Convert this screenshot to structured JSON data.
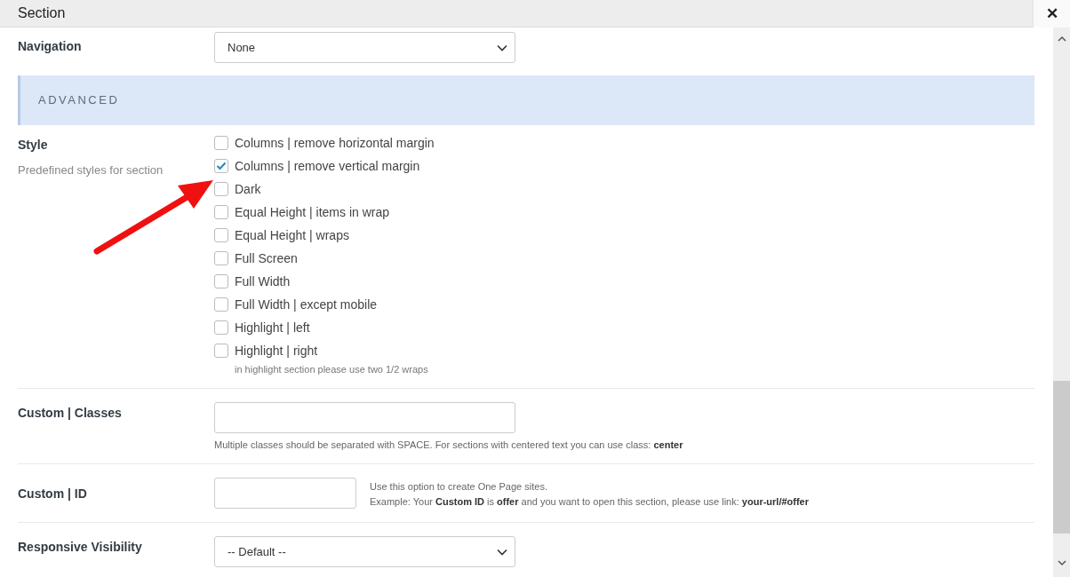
{
  "window": {
    "title": "Section",
    "close": "✕"
  },
  "navigation": {
    "label": "Navigation",
    "value": "None"
  },
  "advanced": {
    "heading": "ADVANCED"
  },
  "style": {
    "label": "Style",
    "description": "Predefined styles for section",
    "options": [
      {
        "label": "Columns | remove horizontal margin",
        "checked": false
      },
      {
        "label": "Columns | remove vertical margin",
        "checked": true
      },
      {
        "label": "Dark",
        "checked": false
      },
      {
        "label": "Equal Height | items in wrap",
        "checked": false
      },
      {
        "label": "Equal Height | wraps",
        "checked": false
      },
      {
        "label": "Full Screen",
        "checked": false
      },
      {
        "label": "Full Width",
        "checked": false
      },
      {
        "label": "Full Width | except mobile",
        "checked": false
      },
      {
        "label": "Highlight | left",
        "checked": false
      },
      {
        "label": "Highlight | right",
        "checked": false
      }
    ],
    "note": "in highlight section please use two 1/2 wraps"
  },
  "custom_classes": {
    "label": "Custom | Classes",
    "help": "Multiple classes should be separated with SPACE. For sections with centered text you can use class: **center**"
  },
  "custom_id": {
    "label": "Custom | ID",
    "help": [
      "Use this option to create One Page sites.",
      "Example: Your **Custom ID** is **offer** and you want to open this section, please use link: **your-url/#offer**"
    ]
  },
  "responsive_visibility": {
    "label": "Responsive Visibility",
    "value": "-- Default --"
  }
}
